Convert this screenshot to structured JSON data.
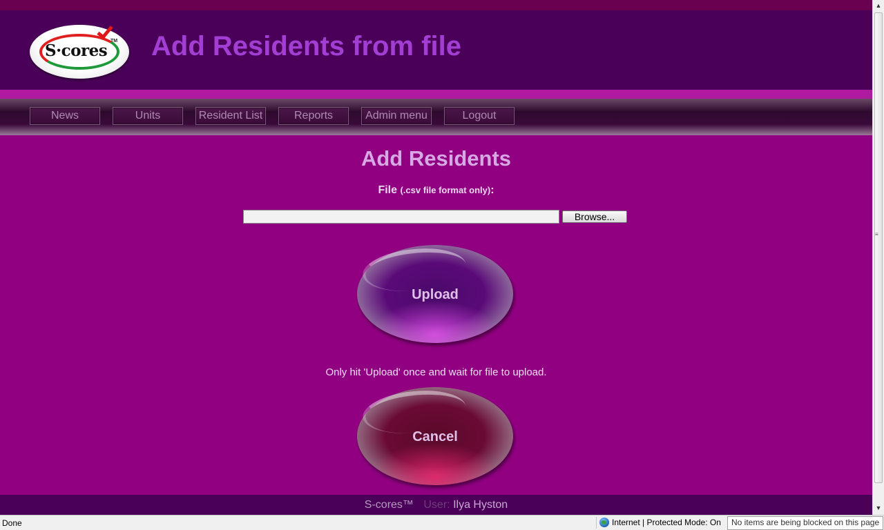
{
  "header": {
    "logo": {
      "text": "S·cores",
      "tm": "TM"
    },
    "title": "Add Residents from file"
  },
  "nav": {
    "items": [
      {
        "label": "News"
      },
      {
        "label": "Units"
      },
      {
        "label": "Resident List"
      },
      {
        "label": "Reports"
      },
      {
        "label": "Admin menu"
      },
      {
        "label": "Logout"
      }
    ]
  },
  "main": {
    "section_title": "Add Residents",
    "file_label": "File",
    "file_hint": "(.csv file format only)",
    "file_colon": ":",
    "file_value": "",
    "browse_label": "Browse...",
    "upload_label": "Upload",
    "note": "Only hit 'Upload' once and wait for file to upload.",
    "cancel_label": "Cancel"
  },
  "footer": {
    "brand": "S-cores™",
    "user_label": "User:",
    "user_name": "Ilya Hyston"
  },
  "statusbar": {
    "status": "Done",
    "zone": "Internet | Protected Mode: On",
    "blocked": "No items are being blocked on this page"
  },
  "colors": {
    "page_bg": "#900080",
    "header_bg": "#4a0058",
    "title": "#a33ed4"
  }
}
